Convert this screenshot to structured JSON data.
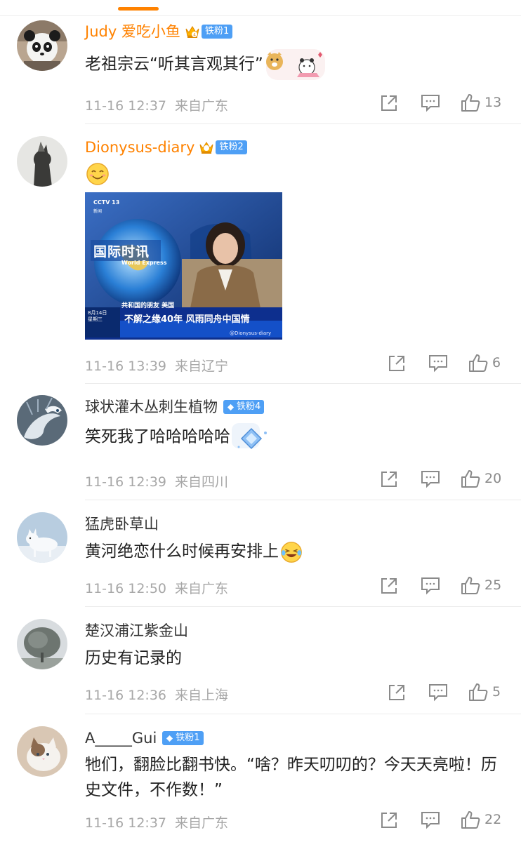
{
  "comments": [
    {
      "name": "Judy 爱吃小鱼",
      "badge": "铁粉1",
      "text": "老祖宗云“听其言观其行”",
      "time": "11-16 12:37",
      "location": "来自广东",
      "likes": "13",
      "avatar": "panda-avatar"
    },
    {
      "name": "Dionysus-diary",
      "badge": "铁粉2",
      "time": "11-16 13:39",
      "location": "来自辽宁",
      "likes": "6",
      "avatar": "statue-avatar",
      "image": {
        "channel": "CCTV 13",
        "channel_sub": "新闻",
        "program": "国际时讯",
        "program_en": "World Express",
        "caption_small": "共和国的朋友 美国",
        "date": "8月14日",
        "weekday": "星期三",
        "headline": "不解之缘40年 风雨同舟中国情",
        "watermark": "@Dionysus-diary"
      }
    },
    {
      "name": "球状灌木丛刺生植物",
      "badge": "铁粉4",
      "text": "笑死我了哈哈哈哈哈",
      "time": "11-16 12:39",
      "location": "来自四川",
      "likes": "20",
      "avatar": "dragon-avatar"
    },
    {
      "name": "猛虎卧草山",
      "text": "黄河绝恋什么时候再安排上",
      "time": "11-16 12:50",
      "location": "来自广东",
      "likes": "25",
      "avatar": "fox-avatar"
    },
    {
      "name": "楚汉浦江紫金山",
      "text": "历史有记录的",
      "time": "11-16 12:36",
      "location": "来自上海",
      "likes": "5",
      "avatar": "tree-avatar"
    },
    {
      "name": "A_____Gui",
      "badge": "铁粉1",
      "text": "牠们，翻脸比翻书快。“啥？昨天叨叨的？今天天亮啦！历史文件，不作数！”",
      "time": "11-16 12:37",
      "location": "来自广东",
      "likes": "22",
      "avatar": "cat-avatar"
    }
  ],
  "colors": {
    "accent": "#ff8200",
    "badge": "#4e9ff5",
    "meta": "#a7a7a7"
  },
  "icons": [
    "share-icon",
    "comment-icon",
    "like-icon",
    "crown-icon",
    "diamond-icon"
  ]
}
